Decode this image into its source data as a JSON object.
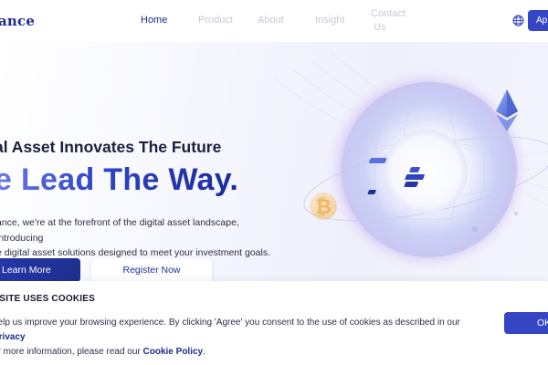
{
  "header": {
    "logo_text": "ance",
    "nav": {
      "home": "Home",
      "product": "Product",
      "about": "About",
      "insight": "Insight",
      "contact_line1": "Contact",
      "contact_line2": "Us"
    },
    "apply_label": "Ap"
  },
  "hero": {
    "subhead": "al Asset Innovates The Future",
    "headline": "e Lead The Way.",
    "description_line1": "ance, we're at the forefront of the digital asset landscape, introducing",
    "description_line2": "e digital asset solutions designed to meet your investment goals.",
    "learn_more_label": "Learn More",
    "register_label": "Register Now"
  },
  "cookie": {
    "title": "BSITE USES COOKIES",
    "text_part1": "help us improve your browsing experience. By clicking 'Agree' you consent to the use of cookies as described in our ",
    "privacy_link": "Privacy",
    "text_part2": "or more information, please read our ",
    "cookie_policy_link": "Cookie Policy",
    "text_part3": ".",
    "ok_label": "OK"
  },
  "colors": {
    "brand": "#1f2a8a",
    "accent": "#3446c4",
    "nav_inactive": "#c7c9d3",
    "bitcoin": "#f0a93b",
    "ethereum": "#5b75d6"
  },
  "icons": {
    "globe": "globe-icon",
    "bitcoin": "bitcoin-icon",
    "ethereum": "ethereum-icon",
    "brand_mark": "brand-mark-icon"
  }
}
